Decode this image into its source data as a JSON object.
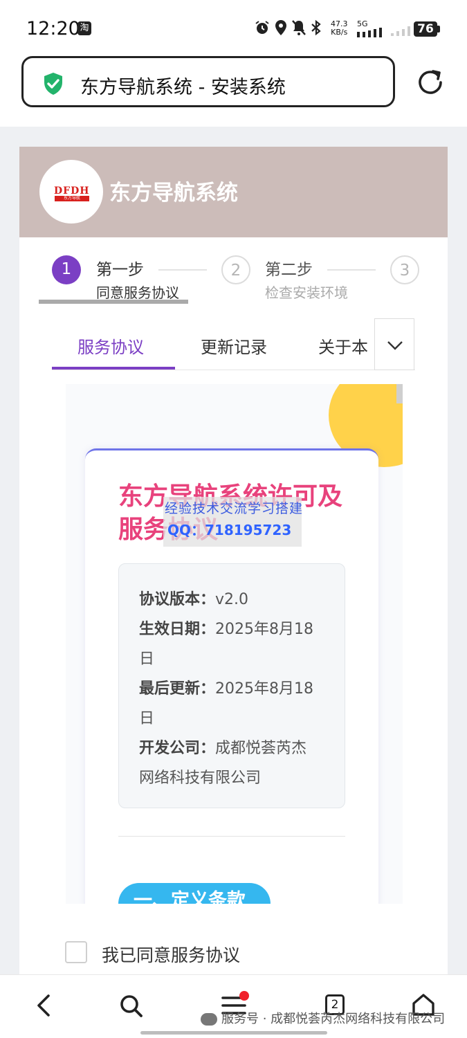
{
  "status_bar": {
    "time": "12:20",
    "app_badge": "淘",
    "net_speed_value": "47.3",
    "net_speed_unit": "KB/s",
    "network_type": "5G",
    "battery": "76"
  },
  "browser": {
    "address_text": "东方导航系统 - 安装系统",
    "secure_icon": "shield-check-icon",
    "reload_icon": "reload-icon"
  },
  "header": {
    "logo_text": "DFDH",
    "logo_subtext": "东方导航",
    "title": "东方导航系统"
  },
  "steps": [
    {
      "number": "1",
      "title": "第一步",
      "subtitle": "同意服务协议",
      "state": "active"
    },
    {
      "number": "2",
      "title": "第二步",
      "subtitle": "检查安装环境",
      "state": "pending"
    },
    {
      "number": "3",
      "title": "",
      "subtitle": "",
      "state": "pending"
    }
  ],
  "tabs": [
    {
      "label": "服务协议",
      "active": true
    },
    {
      "label": "更新记录",
      "active": false
    },
    {
      "label": "关于本",
      "active": false
    }
  ],
  "agreement": {
    "title": "东方导航系统许可及服务协议",
    "info": [
      {
        "label": "协议版本：",
        "value": "v2.0"
      },
      {
        "label": "生效日期：",
        "value": "2025年8月18日"
      },
      {
        "label": "最后更新：",
        "value": "2025年8月18日"
      },
      {
        "label": "开发公司：",
        "value": "成都悦荟芮杰网络科技有限公司"
      }
    ],
    "section_pill": "一、定义条款"
  },
  "watermark": {
    "line1": "经验技术交流学习搭建",
    "line2": "QQ：718195723"
  },
  "agree": {
    "label": "我已同意服务协议",
    "checked": false
  },
  "bottom_nav": {
    "tab_count": "2",
    "footer_watermark": "服务号 · 成都悦荟芮杰网络科技有限公司"
  },
  "colors": {
    "accent": "#7b3fc4",
    "header_bg": "#ccbcb9",
    "title_pink": "#e8427c",
    "pill_blue": "#35b7ef",
    "secure_green": "#23b36b"
  }
}
